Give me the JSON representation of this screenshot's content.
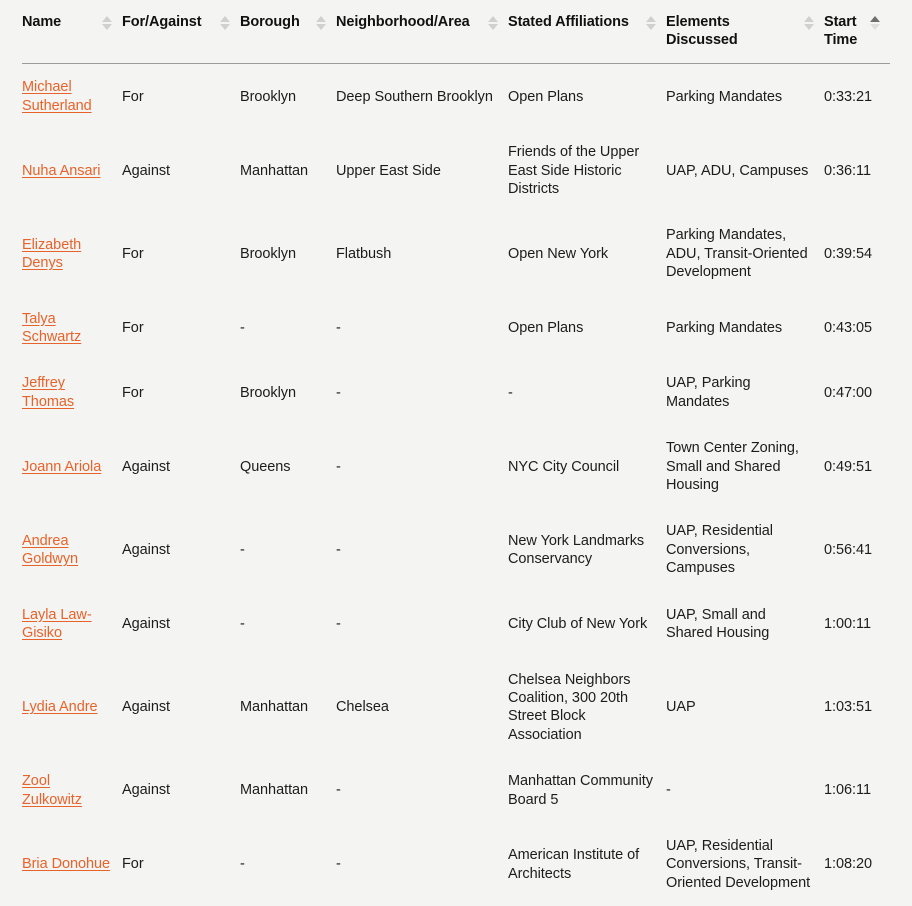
{
  "table": {
    "name": "speaker-testimony-table",
    "columns": [
      {
        "key": "name",
        "label": "Name",
        "sort": "none"
      },
      {
        "key": "stance",
        "label": "For/Against",
        "sort": "none"
      },
      {
        "key": "borough",
        "label": "Borough",
        "sort": "none"
      },
      {
        "key": "hood",
        "label": "Neighborhood/Area",
        "sort": "none"
      },
      {
        "key": "affil",
        "label": "Stated Affiliations",
        "sort": "none"
      },
      {
        "key": "elements",
        "label": "Elements Discussed",
        "sort": "none"
      },
      {
        "key": "time",
        "label": "Start Time",
        "sort": "asc"
      }
    ],
    "rows": [
      {
        "name": "Michael Sutherland",
        "stance": "For",
        "borough": "Brooklyn",
        "hood": "Deep Southern Brooklyn",
        "affil": "Open Plans",
        "elements": "Parking Mandates",
        "time": "0:33:21"
      },
      {
        "name": "Nuha Ansari",
        "stance": "Against",
        "borough": "Manhattan",
        "hood": "Upper East Side",
        "affil": "Friends of the Upper East Side Historic Districts",
        "elements": "UAP, ADU, Campuses",
        "time": "0:36:11"
      },
      {
        "name": "Elizabeth Denys",
        "stance": "For",
        "borough": "Brooklyn",
        "hood": "Flatbush",
        "affil": "Open New York",
        "elements": "Parking Mandates, ADU, Transit-Oriented Development",
        "time": "0:39:54"
      },
      {
        "name": "Talya Schwartz",
        "stance": "For",
        "borough": "-",
        "hood": "-",
        "affil": "Open Plans",
        "elements": "Parking Mandates",
        "time": "0:43:05"
      },
      {
        "name": "Jeffrey Thomas",
        "stance": "For",
        "borough": "Brooklyn",
        "hood": "-",
        "affil": "-",
        "elements": "UAP, Parking Mandates",
        "time": "0:47:00"
      },
      {
        "name": "Joann Ariola",
        "stance": "Against",
        "borough": "Queens",
        "hood": "-",
        "affil": "NYC City Council",
        "elements": "Town Center Zoning, Small and Shared Housing",
        "time": "0:49:51"
      },
      {
        "name": "Andrea Goldwyn",
        "stance": "Against",
        "borough": "-",
        "hood": "-",
        "affil": "New York Landmarks Conservancy",
        "elements": "UAP, Residential Conversions, Campuses",
        "time": "0:56:41"
      },
      {
        "name": "Layla Law-Gisiko",
        "stance": "Against",
        "borough": "-",
        "hood": "-",
        "affil": "City Club of New York",
        "elements": "UAP, Small and Shared Housing",
        "time": "1:00:11"
      },
      {
        "name": "Lydia Andre",
        "stance": "Against",
        "borough": "Manhattan",
        "hood": "Chelsea",
        "affil": "Chelsea Neighbors Coalition, 300 20th Street Block Association",
        "elements": "UAP",
        "time": "1:03:51"
      },
      {
        "name": "Zool Zulkowitz",
        "stance": "Against",
        "borough": "Manhattan",
        "hood": "-",
        "affil": "Manhattan Community Board 5",
        "elements": "-",
        "time": "1:06:11"
      },
      {
        "name": "Bria Donohue",
        "stance": "For",
        "borough": "-",
        "hood": "-",
        "affil": "American Institute of Architects",
        "elements": "UAP, Residential Conversions, Transit-Oriented Development",
        "time": "1:08:20"
      }
    ]
  },
  "colors": {
    "link": "#e8632a",
    "background": "#f4f4f3",
    "text": "#1c1c1c",
    "header_rule": "#9a9a9a",
    "sort_inactive": "#d0d0cf",
    "sort_active": "#6e6e6e"
  }
}
